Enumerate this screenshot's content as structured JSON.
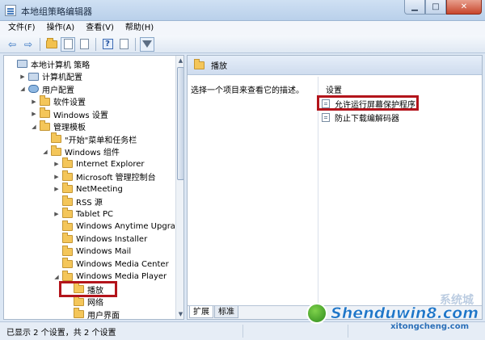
{
  "window": {
    "title": "本地组策略编辑器"
  },
  "menubar": {
    "items": [
      "文件(F)",
      "操作(A)",
      "查看(V)",
      "帮助(H)"
    ]
  },
  "tree": {
    "rows": [
      {
        "label": "本地计算机 策略",
        "depth": 0,
        "expander": "",
        "icon": "pc"
      },
      {
        "label": "计算机配置",
        "depth": 1,
        "expander": "▶",
        "icon": "pc"
      },
      {
        "label": "用户配置",
        "depth": 1,
        "expander": "◢",
        "icon": "user"
      },
      {
        "label": "软件设置",
        "depth": 2,
        "expander": "▶",
        "icon": "folder"
      },
      {
        "label": "Windows 设置",
        "depth": 2,
        "expander": "▶",
        "icon": "folder"
      },
      {
        "label": "管理模板",
        "depth": 2,
        "expander": "◢",
        "icon": "folder"
      },
      {
        "label": "\"开始\"菜单和任务栏",
        "depth": 3,
        "expander": "",
        "icon": "folder"
      },
      {
        "label": "Windows 组件",
        "depth": 3,
        "expander": "◢",
        "icon": "folder"
      },
      {
        "label": "Internet Explorer",
        "depth": 4,
        "expander": "▶",
        "icon": "folder"
      },
      {
        "label": "Microsoft 管理控制台",
        "depth": 4,
        "expander": "▶",
        "icon": "folder"
      },
      {
        "label": "NetMeeting",
        "depth": 4,
        "expander": "▶",
        "icon": "folder"
      },
      {
        "label": "RSS 源",
        "depth": 4,
        "expander": "",
        "icon": "folder"
      },
      {
        "label": "Tablet PC",
        "depth": 4,
        "expander": "▶",
        "icon": "folder"
      },
      {
        "label": "Windows Anytime Upgrade",
        "depth": 4,
        "expander": "",
        "icon": "folder"
      },
      {
        "label": "Windows Installer",
        "depth": 4,
        "expander": "",
        "icon": "folder"
      },
      {
        "label": "Windows Mail",
        "depth": 4,
        "expander": "",
        "icon": "folder"
      },
      {
        "label": "Windows Media Center",
        "depth": 4,
        "expander": "",
        "icon": "folder"
      },
      {
        "label": "Windows Media Player",
        "depth": 4,
        "expander": "◢",
        "icon": "folder"
      },
      {
        "label": "播放",
        "depth": 5,
        "expander": "",
        "icon": "folder"
      },
      {
        "label": "网络",
        "depth": 5,
        "expander": "",
        "icon": "folder"
      },
      {
        "label": "用户界面",
        "depth": 5,
        "expander": "",
        "icon": "folder"
      }
    ]
  },
  "detail": {
    "header": "播放",
    "description": "选择一个项目来查看它的描述。",
    "settings_header": "设置",
    "settings": [
      "允许运行屏幕保护程序",
      "防止下载编解码器"
    ],
    "tabs": [
      "扩展",
      "标准"
    ]
  },
  "status": {
    "text": "已显示 2 个设置，共 2 个设置"
  },
  "watermark": {
    "main": "Shenduwin8.com",
    "sub": "xitongcheng.com",
    "faint": "系统城"
  },
  "colors": {
    "highlight": "#b3141b",
    "folder": "#f4c65a"
  }
}
